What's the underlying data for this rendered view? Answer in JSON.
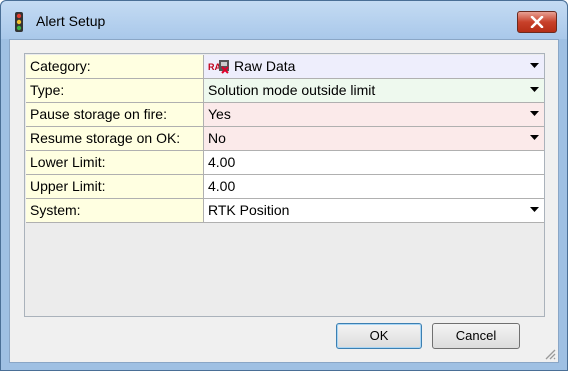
{
  "window": {
    "title": "Alert Setup"
  },
  "properties": [
    {
      "label": "Category:",
      "value": "Raw Data",
      "icon": "raw-data-icon",
      "dropdown": true
    },
    {
      "label": "Type:",
      "value": "Solution mode outside limit",
      "dropdown": true
    },
    {
      "label": "Pause storage on fire:",
      "value": "Yes",
      "dropdown": true
    },
    {
      "label": "Resume storage on OK:",
      "value": "No",
      "dropdown": true
    },
    {
      "label": "Lower Limit:",
      "value": "4.00",
      "dropdown": false
    },
    {
      "label": "Upper Limit:",
      "value": "4.00",
      "dropdown": false
    },
    {
      "label": "System:",
      "value": "RTK Position",
      "dropdown": true
    }
  ],
  "buttons": {
    "ok_label": "OK",
    "cancel_label": "Cancel"
  },
  "colors": {
    "label_bg": "#ffffe1",
    "category_bg": "#eeeefc",
    "type_bg": "#eef9ee",
    "storage_bg": "#fbeaea",
    "close_button": "#c8412a",
    "title_bar": "#b6d1ee"
  }
}
